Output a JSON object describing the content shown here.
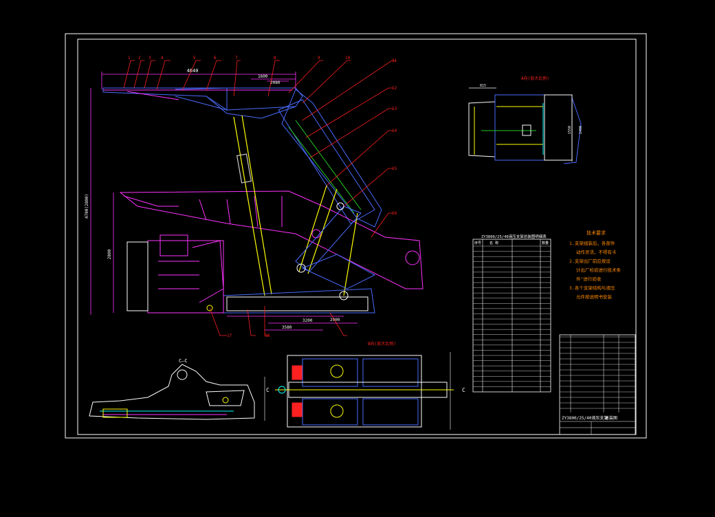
{
  "part_numbers_top": [
    "1",
    "2",
    "3",
    "4",
    "5",
    "6",
    "7",
    "8",
    "9",
    "10",
    "11",
    "12",
    "13",
    "14",
    "15",
    "16",
    "17",
    "18"
  ],
  "view_labels": {
    "view_a": "A向(放大比例)",
    "view_b": "B向(放大比例)",
    "section_left": "C—C",
    "section_mark": "C"
  },
  "dimensions": {
    "top_width": "4640",
    "top_small": "1600",
    "top_small2": "2080",
    "left_height": "4700(2800)",
    "mid_height": "2800",
    "base_1": "2900",
    "base_2": "3580",
    "base_3": "3200",
    "view_a_width": "815",
    "view_a_h1": "1550",
    "view_a_h2": "1400"
  },
  "parts_table": {
    "title": "ZY3800/25/40液压支架总装图明细表",
    "header": [
      "序号",
      "名 称",
      "数量"
    ],
    "row_count": 28
  },
  "tech_requirements": {
    "title": "技术要求",
    "lines": [
      "1.支架组装后，各部件",
      "动作灵活，不得有卡",
      "2.支架出厂前应按设",
      "计出厂检验进行技术条",
      "件\"进行验收",
      "3.各个支架结构与液压",
      "元件按说明书安装"
    ]
  },
  "title_block": {
    "drawing_name": "ZY3800/25/40液压支架",
    "drawing_sub": "总装图"
  },
  "colors": {
    "background": "#000000",
    "frame": "#ffffff",
    "leader": "#ff2020",
    "structure": "#4a6cff",
    "magenta": "#ff33ff",
    "yellow": "#ffff00",
    "cyan": "#00ffff",
    "green": "#22cc22",
    "orange": "#ff8a00"
  }
}
